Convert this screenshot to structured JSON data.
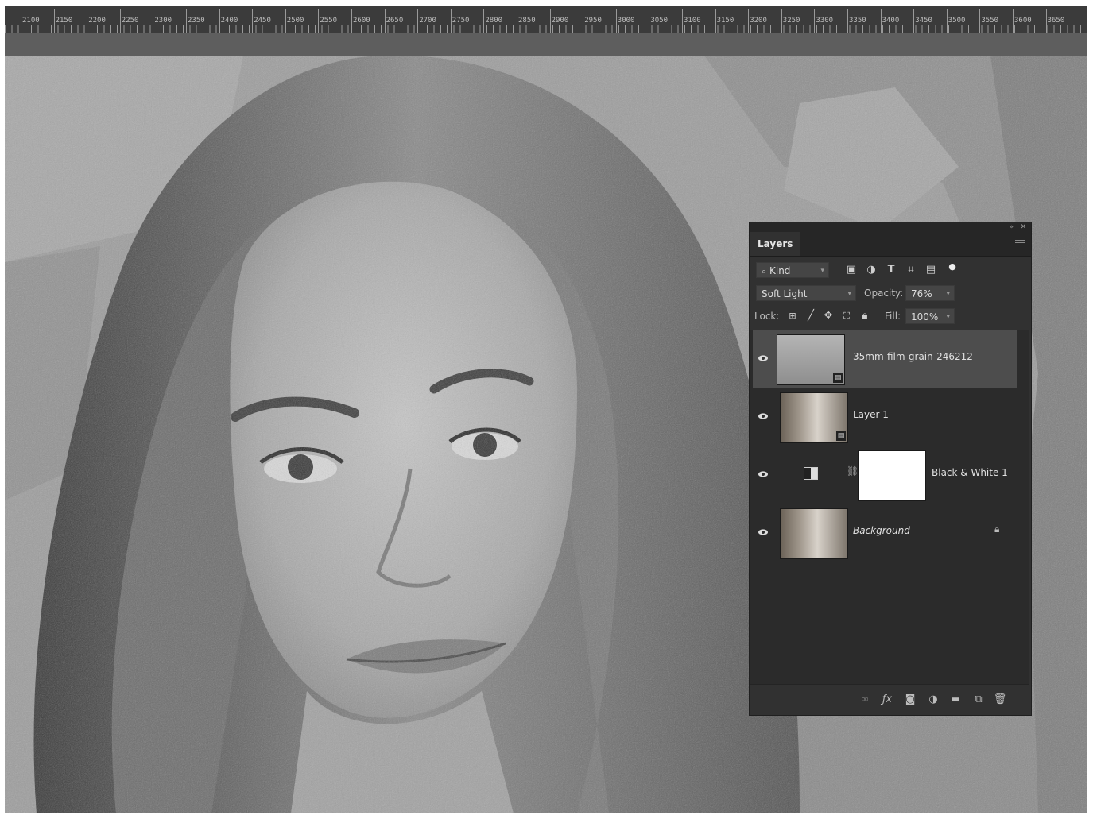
{
  "ruler": {
    "labels": [
      "2100",
      "2150",
      "2200",
      "2250",
      "2300",
      "2350",
      "2400",
      "2450",
      "2500",
      "2550",
      "2600",
      "2650",
      "2700",
      "2750",
      "2800",
      "2850",
      "2900",
      "2950",
      "3000",
      "3050",
      "3100",
      "3150",
      "3200",
      "3250",
      "3300",
      "3350",
      "3400",
      "3450",
      "3500",
      "3550",
      "3600",
      "3650"
    ]
  },
  "panel": {
    "tab_label": "Layers",
    "filter": {
      "label": "Kind",
      "icons": [
        "pixel-filter-icon",
        "adjustment-filter-icon",
        "type-filter-icon",
        "shape-filter-icon",
        "smart-object-filter-icon",
        "filter-toggle-icon"
      ]
    },
    "blend_mode": "Soft Light",
    "opacity_label": "Opacity:",
    "opacity_value": "76%",
    "lock_label": "Lock:",
    "fill_label": "Fill:",
    "fill_value": "100%",
    "layers": [
      {
        "name": "35mm-film-grain-246212",
        "selected": true,
        "italic": false
      },
      {
        "name": "Layer 1",
        "selected": false,
        "italic": false
      },
      {
        "name": "Black & White 1",
        "selected": false,
        "italic": false
      },
      {
        "name": "Background",
        "selected": false,
        "italic": true
      }
    ],
    "footer_icons": [
      "link-layers-icon",
      "fx-icon",
      "add-mask-icon",
      "new-adjustment-icon",
      "new-group-icon",
      "new-layer-icon",
      "delete-layer-icon"
    ]
  }
}
